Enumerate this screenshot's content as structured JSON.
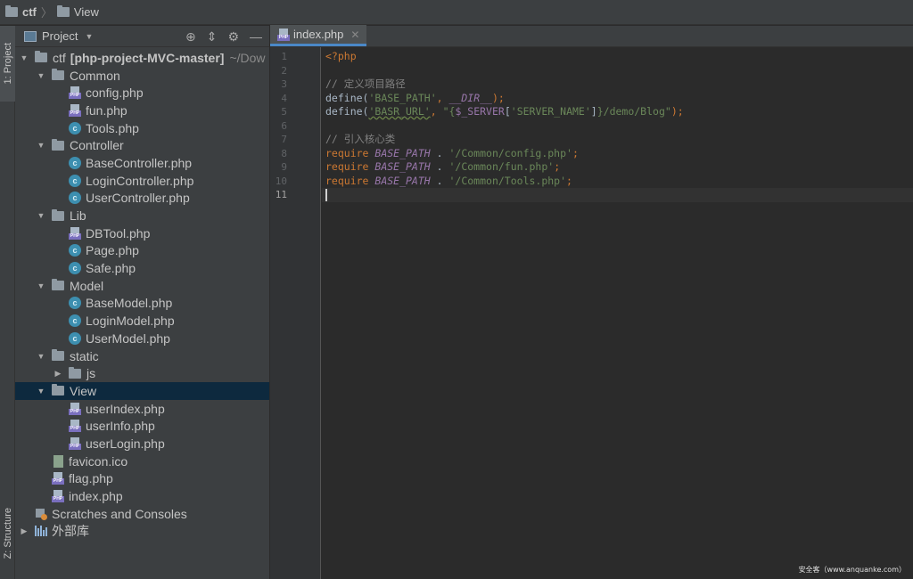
{
  "breadcrumb": {
    "project": "ctf",
    "folder": "View"
  },
  "toolstrip": {
    "project_tab": "1: Project",
    "structure_tab": "Z: Structure"
  },
  "project_panel": {
    "title": "Project",
    "tree": [
      {
        "label": "ctf",
        "bold_suffix": "[php-project-MVC-master]",
        "hint": "~/Dow",
        "type": "folder",
        "depth": 0,
        "state": "open"
      },
      {
        "label": "Common",
        "type": "folder",
        "depth": 1,
        "state": "open"
      },
      {
        "label": "config.php",
        "type": "php",
        "depth": 2
      },
      {
        "label": "fun.php",
        "type": "php",
        "depth": 2
      },
      {
        "label": "Tools.php",
        "type": "class",
        "depth": 2
      },
      {
        "label": "Controller",
        "type": "folder",
        "depth": 1,
        "state": "open"
      },
      {
        "label": "BaseController.php",
        "type": "class",
        "depth": 2
      },
      {
        "label": "LoginController.php",
        "type": "class",
        "depth": 2
      },
      {
        "label": "UserController.php",
        "type": "class",
        "depth": 2
      },
      {
        "label": "Lib",
        "type": "folder",
        "depth": 1,
        "state": "open"
      },
      {
        "label": "DBTool.php",
        "type": "php",
        "depth": 2
      },
      {
        "label": "Page.php",
        "type": "class",
        "depth": 2
      },
      {
        "label": "Safe.php",
        "type": "class",
        "depth": 2
      },
      {
        "label": "Model",
        "type": "folder",
        "depth": 1,
        "state": "open"
      },
      {
        "label": "BaseModel.php",
        "type": "class",
        "depth": 2
      },
      {
        "label": "LoginModel.php",
        "type": "class",
        "depth": 2
      },
      {
        "label": "UserModel.php",
        "type": "class",
        "depth": 2
      },
      {
        "label": "static",
        "type": "folder",
        "depth": 1,
        "state": "open"
      },
      {
        "label": "js",
        "type": "folder",
        "depth": 2,
        "state": "closed"
      },
      {
        "label": "View",
        "type": "folder",
        "depth": 1,
        "state": "open",
        "selected": true
      },
      {
        "label": "userIndex.php",
        "type": "php",
        "depth": 2
      },
      {
        "label": "userInfo.php",
        "type": "php",
        "depth": 2
      },
      {
        "label": "userLogin.php",
        "type": "php",
        "depth": 2
      },
      {
        "label": "favicon.ico",
        "type": "file",
        "depth": 1
      },
      {
        "label": "flag.php",
        "type": "php",
        "depth": 1
      },
      {
        "label": "index.php",
        "type": "php",
        "depth": 1
      },
      {
        "label": "Scratches and Consoles",
        "type": "scratch",
        "depth": 0
      },
      {
        "label": "外部库",
        "type": "library",
        "depth": 0,
        "state": "closed"
      }
    ]
  },
  "editor": {
    "tab_label": "index.php",
    "current_line": 11,
    "lines": [
      [
        {
          "t": "<?php",
          "c": "tag"
        }
      ],
      [],
      [
        {
          "t": "// 定义项目路径",
          "c": "comment"
        }
      ],
      [
        {
          "t": "define(",
          "c": "fn"
        },
        {
          "t": "'BASE_PATH'",
          "c": "str"
        },
        {
          "t": ", ",
          "c": "punct"
        },
        {
          "t": "__DIR__",
          "c": "magic"
        },
        {
          "t": ");",
          "c": "punct"
        }
      ],
      [
        {
          "t": "define(",
          "c": "fn"
        },
        {
          "t": "'BASR_URL'",
          "c": "str typo"
        },
        {
          "t": ", ",
          "c": "punct"
        },
        {
          "t": "\"{",
          "c": "str"
        },
        {
          "t": "$_SERVER",
          "c": "var"
        },
        {
          "t": "[",
          "c": "plain"
        },
        {
          "t": "'SERVER_NAME'",
          "c": "str"
        },
        {
          "t": "]",
          "c": "plain"
        },
        {
          "t": "}/demo/Blog\"",
          "c": "str"
        },
        {
          "t": ");",
          "c": "punct"
        }
      ],
      [],
      [
        {
          "t": "// 引入核心类",
          "c": "comment"
        }
      ],
      [
        {
          "t": "require ",
          "c": "kw"
        },
        {
          "t": "BASE_PATH",
          "c": "const"
        },
        {
          "t": " . ",
          "c": "plain"
        },
        {
          "t": "'/Common/config.php'",
          "c": "str"
        },
        {
          "t": ";",
          "c": "punct"
        }
      ],
      [
        {
          "t": "require ",
          "c": "kw"
        },
        {
          "t": "BASE_PATH",
          "c": "const"
        },
        {
          "t": " . ",
          "c": "plain"
        },
        {
          "t": "'/Common/fun.php'",
          "c": "str"
        },
        {
          "t": ";",
          "c": "punct"
        }
      ],
      [
        {
          "t": "require ",
          "c": "kw"
        },
        {
          "t": "BASE_PATH",
          "c": "const"
        },
        {
          "t": " . ",
          "c": "plain"
        },
        {
          "t": "'/Common/Tools.php'",
          "c": "str"
        },
        {
          "t": ";",
          "c": "punct"
        }
      ],
      []
    ]
  },
  "watermark": "安全客（www.anquanke.com）"
}
